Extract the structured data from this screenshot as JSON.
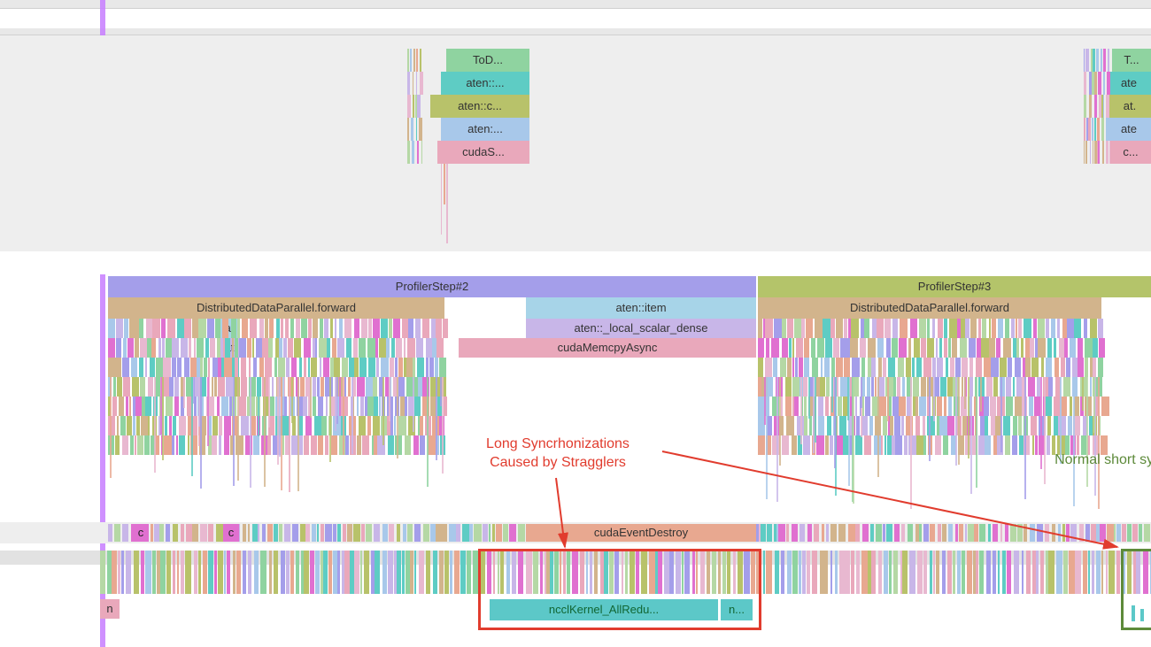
{
  "upper_stack": {
    "rows": [
      {
        "label": "ToD...",
        "color": "c-green"
      },
      {
        "label": "aten::...",
        "color": "c-teal"
      },
      {
        "label": "aten::c...",
        "color": "c-olive"
      },
      {
        "label": "aten:...",
        "color": "c-blue"
      },
      {
        "label": "cudaS...",
        "color": "c-pink"
      }
    ],
    "right_rows": [
      {
        "label": "T...",
        "color": "c-green"
      },
      {
        "label": "ate",
        "color": "c-teal"
      },
      {
        "label": "at.",
        "color": "c-olive"
      },
      {
        "label": "ate",
        "color": "c-blue"
      },
      {
        "label": "c...",
        "color": "c-pink"
      }
    ]
  },
  "mid": {
    "step2_label": "ProfilerStep#2",
    "step3_label": "ProfilerStep#3",
    "ddp_forward": "DistributedDataParallel.forward",
    "aten_item": "aten::item",
    "local_scalar": "aten::_local_scalar_dense",
    "memcpy": "cudaMemcpyAsync",
    "at_label": "at",
    "c_label": "c"
  },
  "lower": {
    "event_destroy": "cudaEventDestroy",
    "c_label": "c",
    "n_label": "n",
    "nccl_kernel": "ncclKernel_AllRedu...",
    "n_short": "n..."
  },
  "annotations": {
    "long_sync_1": "Long Syncrhonizations",
    "long_sync_2": "Caused by Stragglers",
    "normal_sync": "Normal short syn"
  }
}
